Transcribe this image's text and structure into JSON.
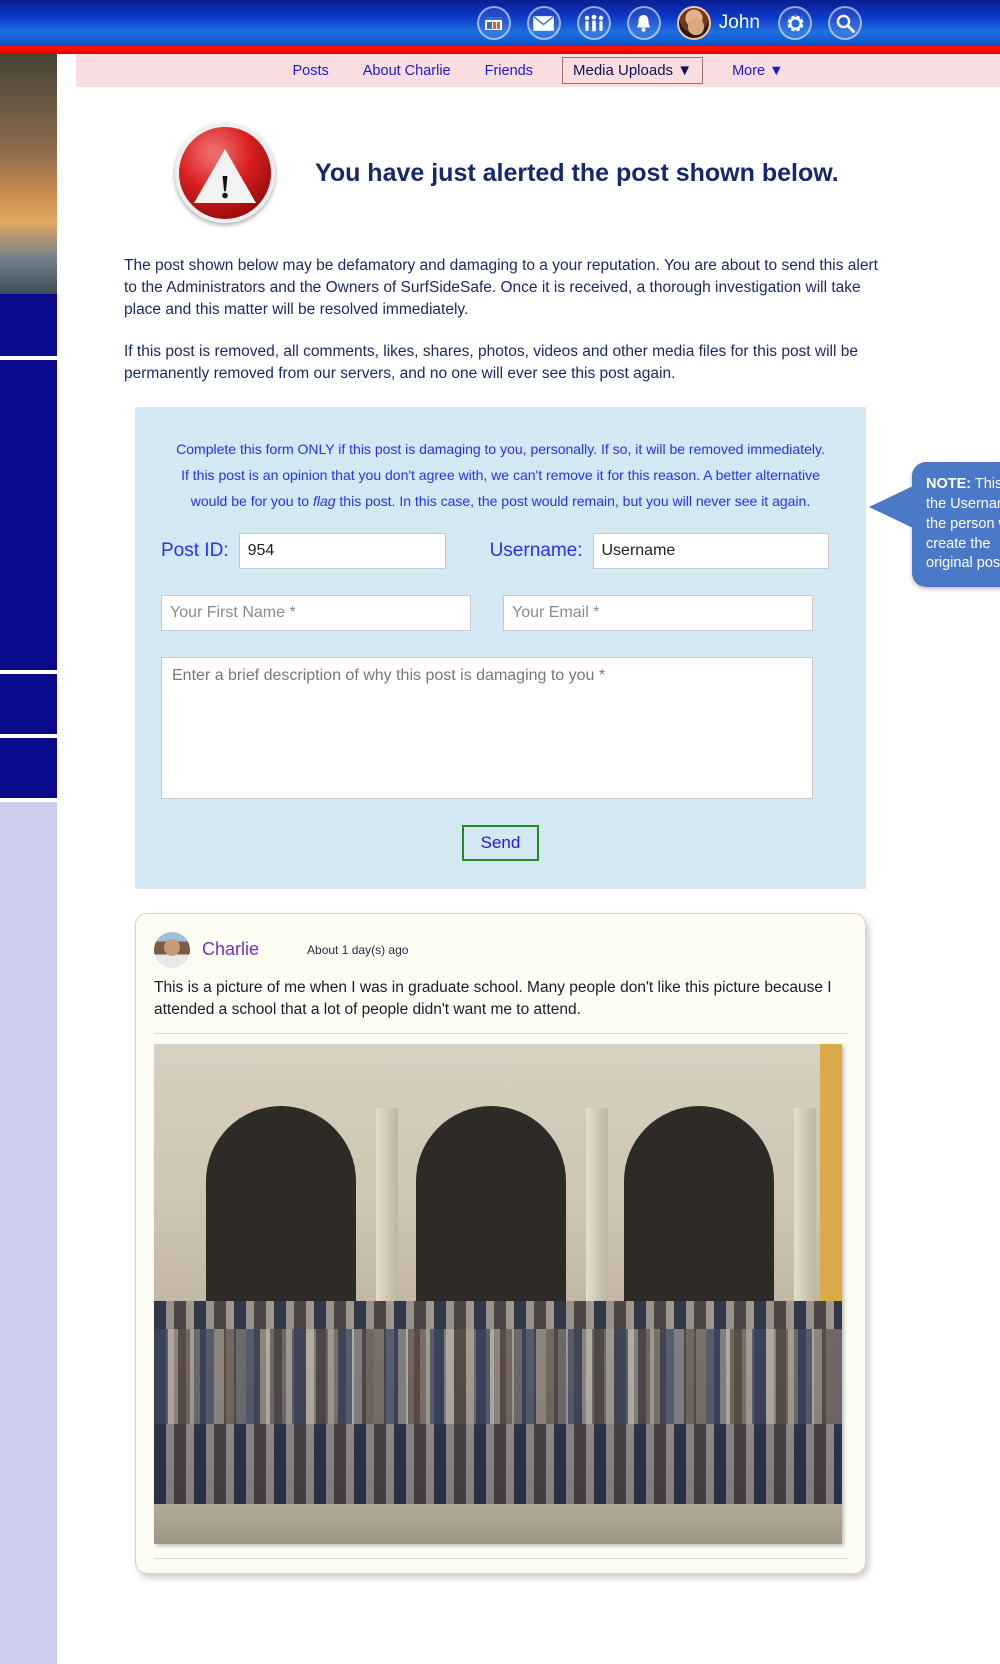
{
  "topbar": {
    "icons": [
      {
        "name": "calendar-icon",
        "glyph": "▤"
      },
      {
        "name": "mail-icon",
        "glyph": "✉"
      },
      {
        "name": "people-icon",
        "glyph": "⚇"
      },
      {
        "name": "bell-icon",
        "glyph": "🔔"
      }
    ],
    "user_name": "John",
    "gear_glyph": "⚙",
    "search_glyph": "🔍"
  },
  "nav": {
    "items": [
      "Posts",
      "About Charlie",
      "Friends"
    ],
    "select_label": "Media Uploads ▼",
    "more_label": "More ▼"
  },
  "alert": {
    "title": "You have just alerted the post shown below.",
    "paragraph1": "The post shown below may be defamatory and damaging to a your reputation. You are about to send this alert to the Administrators and the Owners of SurfSideSafe. Once it is received, a thorough investigation will take place and this matter will be resolved immediately.",
    "paragraph2": "If this post is removed, all comments, likes, shares, photos, videos and other media files for this post will be permanently removed from our servers, and no one will ever see this post again."
  },
  "form": {
    "note_part1": "Complete this form ONLY if this post is damaging to you, personally. If so, it will be removed immediately. If this post is an opinion that you don't agree with, we can't remove it for this reason. A better alternative would be for you to ",
    "note_italic": "flag",
    "note_part2": " this post. In this case, the post would remain, but you will never see it again.",
    "post_id_label": "Post ID:",
    "post_id_value": "954",
    "username_label": "Username:",
    "username_value": "Username",
    "first_name_placeholder": "Your First Name *",
    "email_placeholder": "Your Email *",
    "description_placeholder": "Enter a brief description of why this post is damaging to you *",
    "send_label": "Send"
  },
  "callout": {
    "bold": "NOTE:",
    "text": " This is the Username of the person who create the original post"
  },
  "post": {
    "author": "Charlie",
    "time": "About 1 day(s) ago",
    "text": "This is a picture of me when I was in graduate school. Many people don't like this picture because I attended a school that a lot of people didn't want me to attend."
  },
  "colors": {
    "header_blue": "#0b37c9",
    "red_strip": "#e00000",
    "nav_pink": "#fadde0",
    "link_blue": "#1a1ad0",
    "title_navy": "#16286e",
    "panel_blue": "#d3e8f3",
    "callout_blue": "#4a7ac7",
    "author_purple": "#7b2fc7",
    "send_border_green": "#1e8c1e"
  }
}
